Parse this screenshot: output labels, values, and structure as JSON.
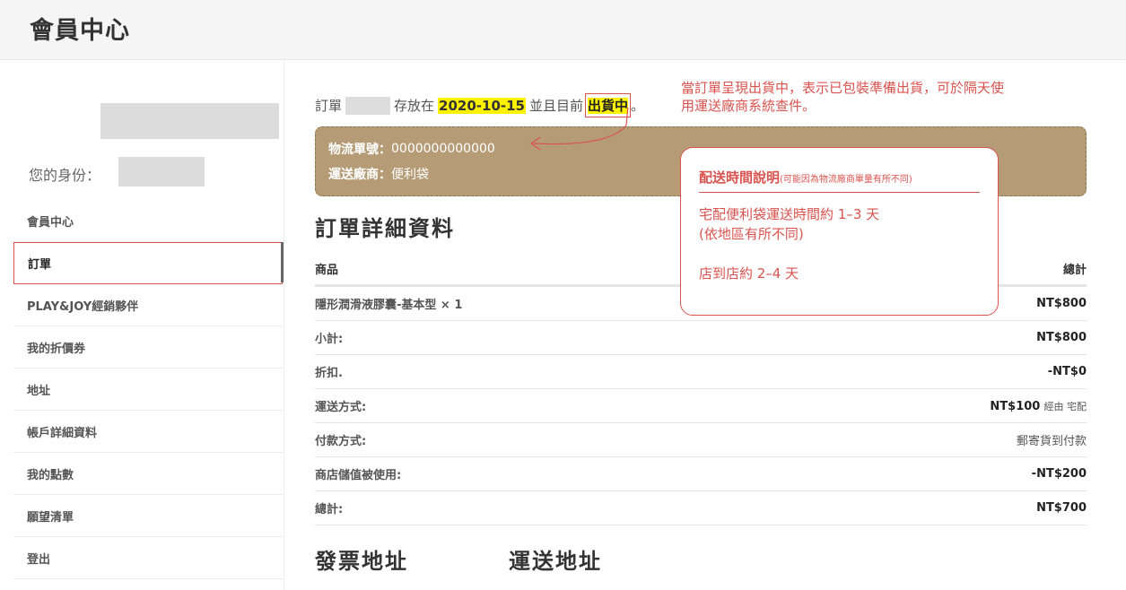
{
  "header": {
    "title": "會員中心"
  },
  "sidebar": {
    "identity_label": "您的身份：",
    "items": [
      {
        "label": "會員中心",
        "active": false
      },
      {
        "label": "訂單",
        "active": true
      },
      {
        "label": "PLAY&JOY經銷夥伴",
        "active": false
      },
      {
        "label": "我的折價券",
        "active": false
      },
      {
        "label": "地址",
        "active": false
      },
      {
        "label": "帳戶詳細資料",
        "active": false
      },
      {
        "label": "我的點數",
        "active": false
      },
      {
        "label": "願望清單",
        "active": false
      },
      {
        "label": "登出",
        "active": false
      }
    ]
  },
  "order": {
    "prefix": "訂單",
    "placed_text": "存放在",
    "date": "2020-10-15",
    "status_text": "並且目前",
    "status": "出貨中",
    "trailing": "。"
  },
  "status_note": "當訂單呈現出貨中，表示已包裝準備出貨，可於隔天使用運送廠商系統查件。",
  "shipping": {
    "tracking_label": "物流單號：",
    "tracking_number": "0000000000000",
    "carrier_label": "運送廠商：",
    "carrier": "便利袋"
  },
  "tip": {
    "title": "配送時間說明",
    "subtitle": "(可能因為物流廠商單量有所不同)",
    "line1": "宅配便利袋運送時間約 1–3 天",
    "line2": "(依地區有所不同)",
    "line3": "店到店約 2–4 天"
  },
  "details": {
    "title": "訂單詳細資料",
    "col_product": "商品",
    "col_total": "總計",
    "product": {
      "name": "隱形潤滑液膠囊-基本型 × 1",
      "price": "NT$800"
    },
    "subtotal": {
      "label": "小計:",
      "value": "NT$800"
    },
    "discount": {
      "label": "折扣.",
      "value": "-NT$0"
    },
    "shipping": {
      "label": "運送方式:",
      "value": "NT$100",
      "note": "經由 宅配"
    },
    "payment": {
      "label": "付款方式:",
      "value": "郵寄貨到付款"
    },
    "store_credit": {
      "label": "商店儲值被使用:",
      "value": "-NT$200"
    },
    "total": {
      "label": "總計:",
      "value": "NT$700"
    }
  },
  "billing_title": "發票地址",
  "shipping_title": "運送地址",
  "colors": {
    "accent_red": "#d9534f",
    "highlight_yellow": "#fff200",
    "shipping_box": "#b59c77"
  }
}
